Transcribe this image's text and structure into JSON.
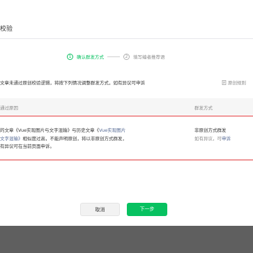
{
  "dialog": {
    "title": "校验"
  },
  "steps": [
    {
      "number": "1",
      "label": "确认群发方式"
    },
    {
      "number": "2",
      "label": "填写编者推荐语"
    }
  ],
  "notice": "文章未通过原创校验逻辑，将按下列情况调整群发方式，如有异议可申诉",
  "original_rules_link": "原创规则",
  "table": {
    "headers": {
      "reason": "通过原因",
      "method": "群发方式"
    },
    "row": {
      "reason_line1_prefix": "的文章《Vue实现图片与文字混输》与历史文章《",
      "reason_link_part1": "Vue实现图片",
      "reason_link_part2": "文字混输》",
      "reason_line2_suffix": "相似度过高，不能声明原创，将以非原创方式群发，",
      "reason_line3": "有异议可在当前页面申诉。",
      "method": "非原创方式群发",
      "method_note": "如有异议，可",
      "appeal_link": "申诉"
    }
  },
  "buttons": {
    "cancel": "取消",
    "next": "下一步"
  },
  "colors": {
    "accent": "#07c160",
    "link": "#576b95",
    "error_border": "#e0383a",
    "overlay": "#5f5f5f"
  }
}
